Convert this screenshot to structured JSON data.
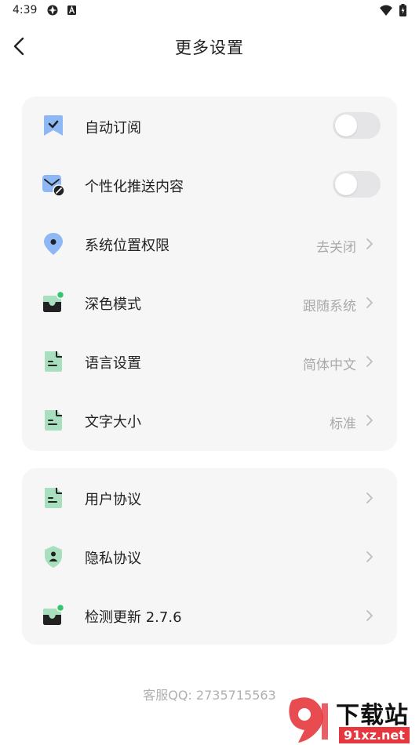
{
  "status_bar": {
    "time": "4:39"
  },
  "header": {
    "title": "更多设置"
  },
  "settings_group_1": [
    {
      "label": "自动订阅",
      "control": "toggle",
      "enabled": false
    },
    {
      "label": "个性化推送内容",
      "control": "toggle",
      "enabled": false
    },
    {
      "label": "系统位置权限",
      "value": "去关闭"
    },
    {
      "label": "深色模式",
      "value": "跟随系统"
    },
    {
      "label": "语言设置",
      "value": "简体中文"
    },
    {
      "label": "文字大小",
      "value": "标准"
    }
  ],
  "settings_group_2": [
    {
      "label": "用户协议"
    },
    {
      "label": "隐私协议"
    },
    {
      "label": "检测更新 2.7.6"
    }
  ],
  "footer": {
    "contact": "客服QQ: 2735715563"
  },
  "watermark": {
    "title": "下载站",
    "url": "91xz.net"
  },
  "colors": {
    "accent_blue": "#8db8f5",
    "accent_green": "#a8e0bf",
    "dark_icon": "#222222",
    "green_dot": "#36c46f",
    "watermark_red": "#e5373d"
  }
}
